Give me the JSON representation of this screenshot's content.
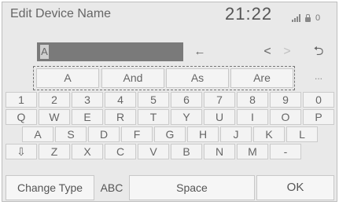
{
  "header": {
    "title": "Edit Device Name",
    "clock": "21:22",
    "status_counter": "0"
  },
  "input": {
    "current_value": "A"
  },
  "controls": {
    "backspace": "←",
    "cursor_left": "<",
    "cursor_right": ">",
    "return": "⮌"
  },
  "suggestions": {
    "items": [
      "A",
      "And",
      "As",
      "Are"
    ],
    "more": "..."
  },
  "keyboard": {
    "row_numbers": [
      "1",
      "2",
      "3",
      "4",
      "5",
      "6",
      "7",
      "8",
      "9",
      "0"
    ],
    "row_top": [
      "Q",
      "W",
      "E",
      "R",
      "T",
      "Y",
      "U",
      "I",
      "O",
      "P"
    ],
    "row_middle": [
      "A",
      "S",
      "D",
      "F",
      "G",
      "H",
      "J",
      "K",
      "L"
    ],
    "row_bottom": [
      "⇩",
      "Z",
      "X",
      "C",
      "V",
      "B",
      "N",
      "M",
      "-"
    ]
  },
  "footer": {
    "change_type": "Change Type",
    "abc": "ABC",
    "space": "Space",
    "ok": "OK"
  }
}
